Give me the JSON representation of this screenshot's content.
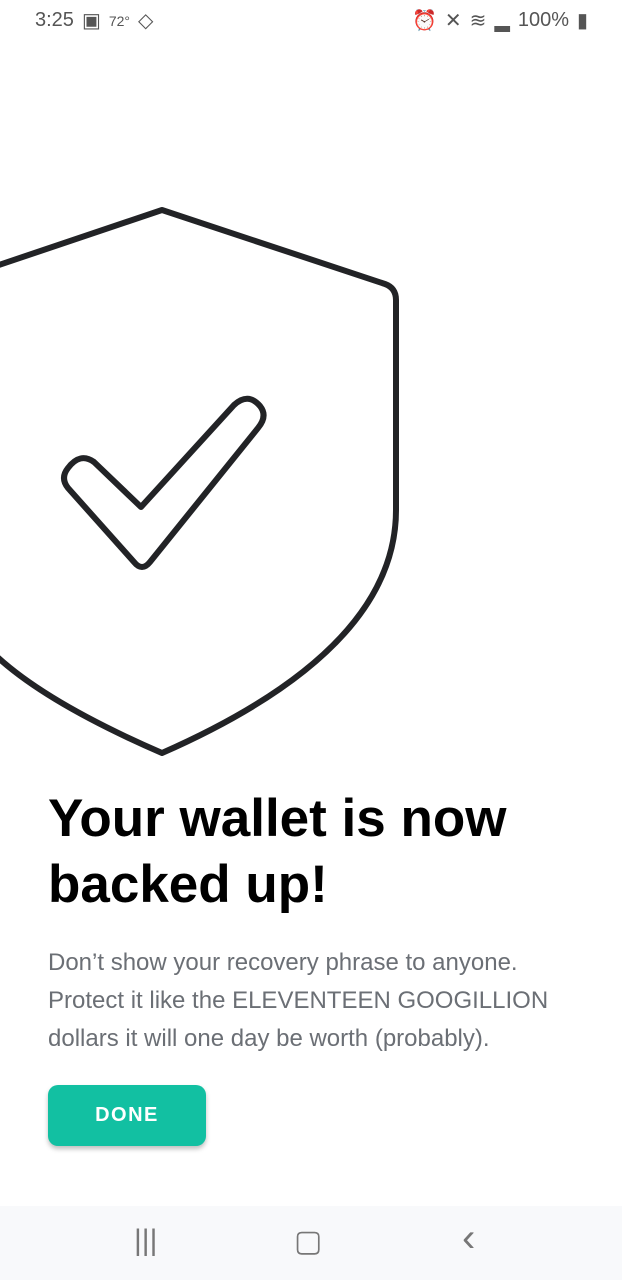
{
  "status": {
    "time": "3:25",
    "temp": "72°",
    "battery": "100%"
  },
  "main": {
    "title": "Your wallet is now backed up!",
    "body": "Don’t show your recovery phrase to anyone. Protect it like the ELEVENTEEN GOOGILLION dollars it will one day be worth (probably).",
    "done_label": "DONE"
  },
  "nav": {
    "recents": "|||",
    "home": "▢",
    "back": "‹"
  }
}
